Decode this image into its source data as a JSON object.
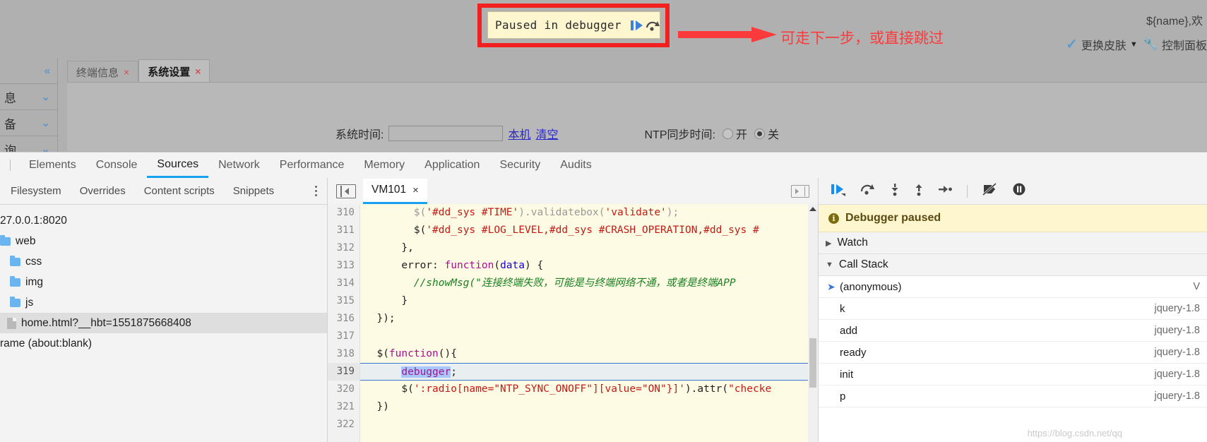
{
  "overlay": {
    "paused_label": "Paused in debugger",
    "resume_icon": "resume-icon",
    "step_over_icon": "step-over-icon",
    "annotation": "可走下一步，或直接跳过"
  },
  "app_header": {
    "user_template": "${name},欢",
    "tools": [
      {
        "icon": "check-icon",
        "label": "更换皮肤",
        "caret": "▼"
      },
      {
        "icon": "wrench-icon",
        "label": "控制面板"
      }
    ]
  },
  "accordion": {
    "items": [
      {
        "label": "",
        "icon": "chevron-double-left-icon"
      },
      {
        "label": "息",
        "icon": "chevron-double-down-icon"
      },
      {
        "label": "备",
        "icon": "chevron-double-down-icon"
      },
      {
        "label": "询",
        "icon": "chevron-double-down-icon"
      }
    ]
  },
  "tabs": [
    {
      "label": "终端信息",
      "active": false,
      "close": "×"
    },
    {
      "label": "系统设置",
      "active": true,
      "close": "×"
    }
  ],
  "settings_form": {
    "time_label": "系统时间:",
    "time_value": "",
    "link_local": "本机",
    "link_clear": "清空",
    "ntp_label": "NTP同步时间:",
    "ntp_options": [
      {
        "label": "开",
        "selected": false
      },
      {
        "label": "关",
        "selected": true
      }
    ]
  },
  "devtools": {
    "tabs": [
      {
        "label": "Elements",
        "active": false
      },
      {
        "label": "Console",
        "active": false
      },
      {
        "label": "Sources",
        "active": true
      },
      {
        "label": "Network",
        "active": false
      },
      {
        "label": "Performance",
        "active": false
      },
      {
        "label": "Memory",
        "active": false
      },
      {
        "label": "Application",
        "active": false
      },
      {
        "label": "Security",
        "active": false
      },
      {
        "label": "Audits",
        "active": false
      }
    ],
    "navigator": {
      "tabs": [
        {
          "label": "Filesystem",
          "active": false
        },
        {
          "label": "Overrides",
          "active": false
        },
        {
          "label": "Content scripts",
          "active": false
        },
        {
          "label": "Snippets",
          "active": false
        }
      ],
      "more_icon": "kebab-menu-icon",
      "tree": [
        {
          "label": "27.0.0.1:8020",
          "type": "origin",
          "indent": 0,
          "selected": false
        },
        {
          "label": "web",
          "type": "folder",
          "indent": 0,
          "selected": false
        },
        {
          "label": "css",
          "type": "folder",
          "indent": 1,
          "selected": false
        },
        {
          "label": "img",
          "type": "folder",
          "indent": 1,
          "selected": false
        },
        {
          "label": "js",
          "type": "folder",
          "indent": 1,
          "selected": false
        },
        {
          "label": "home.html?__hbt=1551875668408",
          "type": "file",
          "indent": 1,
          "selected": true
        },
        {
          "label": "rame (about:blank)",
          "type": "origin",
          "indent": 0,
          "selected": false
        }
      ]
    },
    "editor": {
      "sidebar_toggle_icon": "show-navigator-icon",
      "panel_toggle_icon": "show-debugger-icon",
      "tab_label": "VM101",
      "tab_close": "×",
      "first_line_number": 310,
      "highlight_line": 319,
      "lines": [
        {
          "n": 310,
          "text": "        $('#dd_sys #TIME').validatebox('validate');"
        },
        {
          "n": 311,
          "text": "        $('#dd_sys #LOG_LEVEL,#dd_sys #CRASH_OPERATION,#dd_sys #"
        },
        {
          "n": 312,
          "text": "      },"
        },
        {
          "n": 313,
          "text": "      error: function(data) {"
        },
        {
          "n": 314,
          "text": "        //showMsg(\"连接终端失败，可能是与终端网络不通，或者是终端APP"
        },
        {
          "n": 315,
          "text": "      }"
        },
        {
          "n": 316,
          "text": "  });"
        },
        {
          "n": 317,
          "text": ""
        },
        {
          "n": 318,
          "text": "  $(function(){"
        },
        {
          "n": 319,
          "text": "      debugger;"
        },
        {
          "n": 320,
          "text": "      $(':radio[name=\"NTP_SYNC_ONOFF\"][value=\"ON\"}]').attr(\"checke"
        },
        {
          "n": 321,
          "text": "  })"
        },
        {
          "n": 322,
          "text": ""
        }
      ]
    },
    "debugger_sidebar": {
      "toolbar_icons": [
        "resume-script-execution-icon",
        "step-over-next-function-call-icon",
        "step-into-next-function-call-icon",
        "step-out-of-current-function-icon",
        "step-icon",
        "deactivate-breakpoints-icon",
        "pause-on-exceptions-icon"
      ],
      "status_icon": "info-icon",
      "status_text": "Debugger paused",
      "sections": [
        {
          "label": "Watch",
          "expanded": false,
          "triangle": "▶"
        },
        {
          "label": "Call Stack",
          "expanded": true,
          "triangle": "▼"
        }
      ],
      "call_stack": [
        {
          "name": "(anonymous)",
          "source": "V",
          "current": true
        },
        {
          "name": "k",
          "source": "jquery-1.8",
          "current": false
        },
        {
          "name": "add",
          "source": "jquery-1.8",
          "current": false
        },
        {
          "name": "ready",
          "source": "jquery-1.8",
          "current": false
        },
        {
          "name": "init",
          "source": "jquery-1.8",
          "current": false
        },
        {
          "name": "p",
          "source": "jquery-1.8",
          "current": false
        }
      ],
      "watermark": "https://blog.csdn.net/qq"
    }
  },
  "colors": {
    "accent_blue": "#1aa0f0",
    "annotation_red": "#fb3b3b",
    "paused_yellow": "#fdf6cf",
    "folder_blue": "#6ab4ef"
  }
}
